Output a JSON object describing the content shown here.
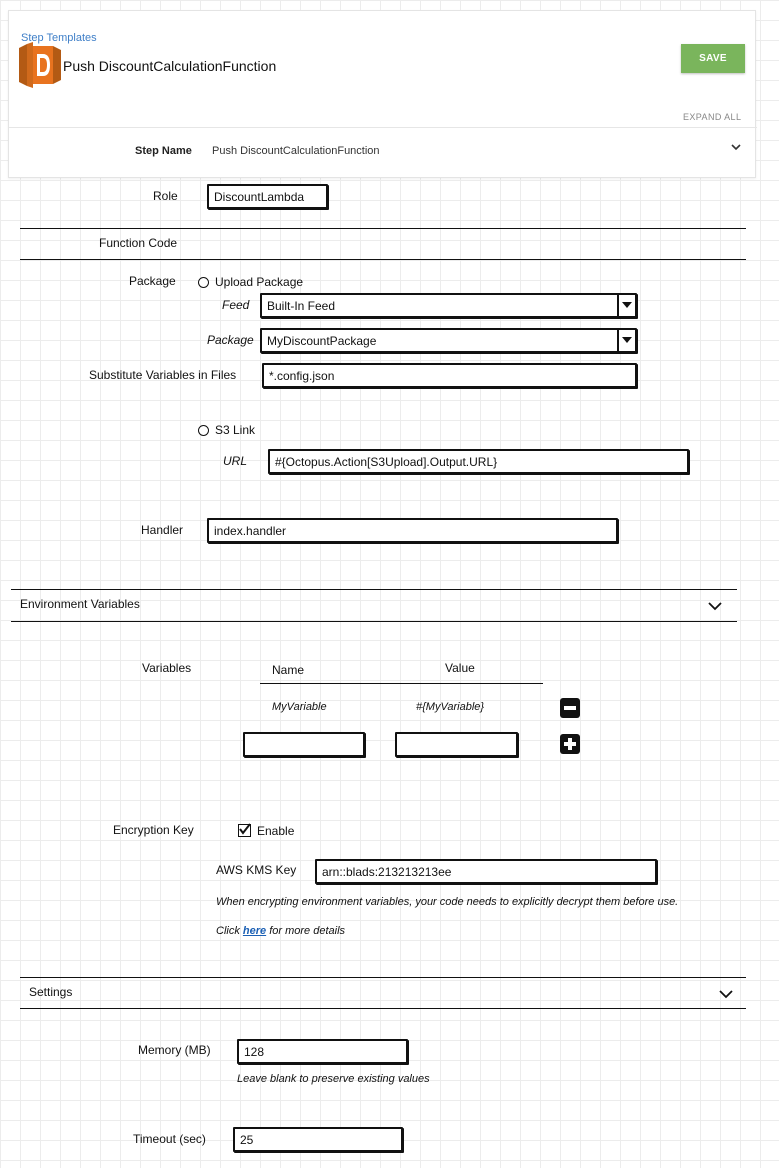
{
  "header": {
    "breadcrumb": "Step Templates",
    "title": "Push DiscountCalculationFunction",
    "save_label": "SAVE",
    "expand_all_label": "EXPAND ALL",
    "step_name_label": "Step Name",
    "step_name_value": "Push DiscountCalculationFunction"
  },
  "role": {
    "label": "Role",
    "value": "DiscountLambda"
  },
  "function_code": {
    "heading": "Function Code",
    "package_label": "Package",
    "upload_option": "Upload Package",
    "feed_label": "Feed",
    "feed_value": "Built-In Feed",
    "package_field_label": "Package",
    "package_value": "MyDiscountPackage",
    "substitute_label": "Substitute Variables in Files",
    "substitute_value": "*.config.json",
    "s3_option": "S3 Link",
    "url_label": "URL",
    "url_value": "#{Octopus.Action[S3Upload].Output.URL}",
    "handler_label": "Handler",
    "handler_value": "index.handler"
  },
  "environment": {
    "heading": "Environment Variables",
    "variables_label": "Variables",
    "col_name": "Name",
    "col_value": "Value",
    "row_name": "MyVariable",
    "row_value": "#{MyVariable}",
    "new_name": "",
    "new_value": "",
    "encryption_label": "Encryption Key",
    "enable_label": "Enable",
    "kms_label": "AWS KMS Key",
    "kms_value": "arn::blads:213213213ee",
    "note_line1": "When encrypting environment variables, your code needs to explicitly decrypt them before use.",
    "note_click": "Click",
    "note_link": "here",
    "note_rest": "for more details"
  },
  "settings": {
    "heading": "Settings",
    "memory_label": "Memory (MB)",
    "memory_value": "128",
    "memory_hint": "Leave blank to preserve existing values",
    "timeout_label": "Timeout (sec)",
    "timeout_value": "25"
  },
  "colors": {
    "save_button": "#7ab55c",
    "link": "#3f7fc8",
    "logo_orange": "#e8731f"
  }
}
